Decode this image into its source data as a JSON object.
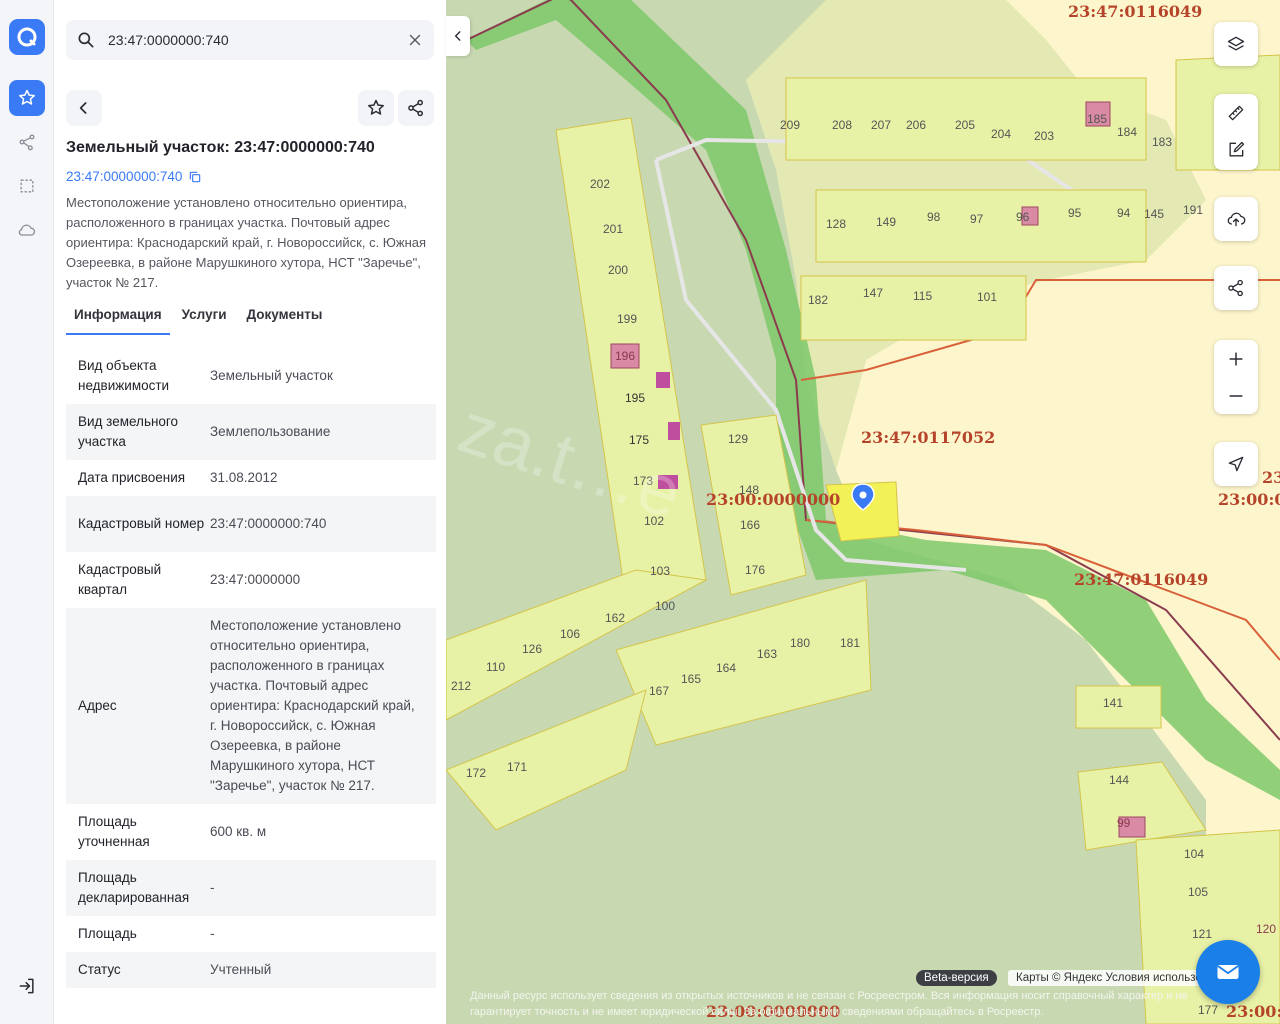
{
  "search": {
    "value": "23:47:0000000:740"
  },
  "card": {
    "title": "Земельный участок: 23:47:0000000:740",
    "cad_link": "23:47:0000000:740",
    "description": "Местоположение установлено относительно ориентира, расположенного в границах участка. Почтовый адрес ориентира: Краснодарский край, г. Новороссийск, с. Южная Озереевка, в районе Марушкиного хутора, НСТ \"Заречье\", участок № 217."
  },
  "tabs": [
    {
      "label": "Информация"
    },
    {
      "label": "Услуги"
    },
    {
      "label": "Документы"
    }
  ],
  "info": [
    {
      "key": "Вид объекта недвижимости",
      "value": "Земельный участок"
    },
    {
      "key": "Вид земельного участка",
      "value": "Землепользование"
    },
    {
      "key": "Дата присвоения",
      "value": "31.08.2012"
    },
    {
      "key": "Кадастровый номер",
      "value": "23:47:0000000:740"
    },
    {
      "key": "Кадастровый квартал",
      "value": "23:47:0000000"
    },
    {
      "key": "Адрес",
      "value": "Местоположение установлено относительно ориентира, расположенного в границах участка. Почтовый адрес ориентира: Краснодарский край, г. Новороссийск, с. Южная Озереевка, в районе Марушкиного хутора, НСТ \"Заречье\", участок № 217."
    },
    {
      "key": "Площадь уточненная",
      "value": "600 кв. м"
    },
    {
      "key": "Площадь декларированная",
      "value": "-"
    },
    {
      "key": "Площадь",
      "value": "-"
    },
    {
      "key": "Статус",
      "value": "Учтенный"
    }
  ],
  "map": {
    "quarter_labels": [
      "23:47:0116049",
      "23:47:0117052",
      "23:00:0000000",
      "23:47:0116049",
      "23:00:0000000",
      "23:00:0",
      "23:00:0000000",
      "23:00:0"
    ],
    "parcel_numbers": [
      "209",
      "208",
      "207",
      "206",
      "205",
      "204",
      "203",
      "185",
      "184",
      "183",
      "128",
      "149",
      "98",
      "97",
      "96",
      "95",
      "94",
      "145",
      "191",
      "182",
      "147",
      "115",
      "101",
      "202",
      "201",
      "200",
      "199",
      "196",
      "195",
      "175",
      "173",
      "102",
      "103",
      "100",
      "129",
      "148",
      "166",
      "176",
      "162",
      "106",
      "126",
      "110",
      "212",
      "163",
      "180",
      "181",
      "164",
      "165",
      "167",
      "172",
      "171",
      "141",
      "144",
      "99",
      "104",
      "105",
      "121",
      "120",
      "177"
    ],
    "watermark": "za.t…e",
    "beta": "Beta-версия",
    "copyright": "Карты © Яндекс   Условия использования",
    "disclaimer": "Данный ресурс использует сведения из открытых источников и не связан с Росреестром. Вся информация носит справочный характер и не гарантирует точность и не имеет юридической силы. За официальными сведениями обращайтесь в Росреестр."
  },
  "colors": {
    "accent": "#3a7bf5",
    "parcel_fill": "#e8f2a6",
    "parcel_stroke": "#d4c44a",
    "quarter_label": "#b5442a",
    "road_green": "#7ec86a"
  }
}
